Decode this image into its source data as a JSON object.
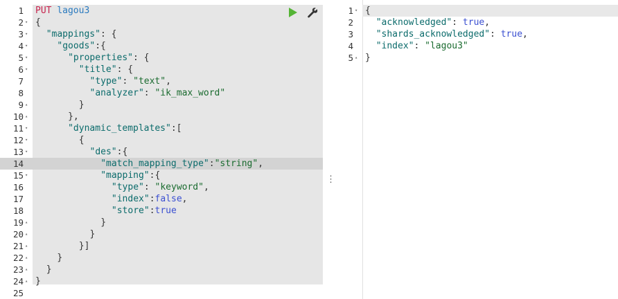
{
  "request": {
    "method": "PUT",
    "index": "lagou3",
    "lines": [
      {
        "n": "1",
        "fold": "",
        "indent": 0,
        "tokens": [
          [
            "method",
            "PUT"
          ],
          [
            "punc",
            " "
          ],
          [
            "url",
            "lagou3"
          ]
        ]
      },
      {
        "n": "2",
        "fold": "▾",
        "indent": 0,
        "tokens": [
          [
            "punc",
            "{"
          ]
        ]
      },
      {
        "n": "3",
        "fold": "▾",
        "indent": 1,
        "tokens": [
          [
            "key",
            "\"mappings\""
          ],
          [
            "punc",
            ": {"
          ]
        ]
      },
      {
        "n": "4",
        "fold": "▾",
        "indent": 2,
        "tokens": [
          [
            "key",
            "\"goods\""
          ],
          [
            "punc",
            ":{"
          ]
        ]
      },
      {
        "n": "5",
        "fold": "▾",
        "indent": 3,
        "tokens": [
          [
            "key",
            "\"properties\""
          ],
          [
            "punc",
            ": {"
          ]
        ]
      },
      {
        "n": "6",
        "fold": "▾",
        "indent": 4,
        "tokens": [
          [
            "key",
            "\"title\""
          ],
          [
            "punc",
            ": {"
          ]
        ]
      },
      {
        "n": "7",
        "fold": "",
        "indent": 5,
        "tokens": [
          [
            "key",
            "\"type\""
          ],
          [
            "punc",
            ": "
          ],
          [
            "str",
            "\"text\""
          ],
          [
            "punc",
            ","
          ]
        ]
      },
      {
        "n": "8",
        "fold": "",
        "indent": 5,
        "tokens": [
          [
            "key",
            "\"analyzer\""
          ],
          [
            "punc",
            ": "
          ],
          [
            "str",
            "\"ik_max_word\""
          ]
        ]
      },
      {
        "n": "9",
        "fold": "▴",
        "indent": 4,
        "tokens": [
          [
            "punc",
            "}"
          ]
        ]
      },
      {
        "n": "10",
        "fold": "▴",
        "indent": 3,
        "tokens": [
          [
            "punc",
            "},"
          ]
        ]
      },
      {
        "n": "11",
        "fold": "▾",
        "indent": 3,
        "tokens": [
          [
            "key",
            "\"dynamic_templates\""
          ],
          [
            "punc",
            ":["
          ]
        ]
      },
      {
        "n": "12",
        "fold": "▾",
        "indent": 4,
        "tokens": [
          [
            "punc",
            "{"
          ]
        ]
      },
      {
        "n": "13",
        "fold": "▾",
        "indent": 5,
        "tokens": [
          [
            "key",
            "\"des\""
          ],
          [
            "punc",
            ":{"
          ]
        ]
      },
      {
        "n": "14",
        "fold": "",
        "indent": 6,
        "tokens": [
          [
            "key",
            "\"match_mapping_type\""
          ],
          [
            "punc",
            ":"
          ],
          [
            "str",
            "\"string\""
          ],
          [
            "punc",
            ","
          ]
        ]
      },
      {
        "n": "15",
        "fold": "▾",
        "indent": 6,
        "tokens": [
          [
            "key",
            "\"mapping\""
          ],
          [
            "punc",
            ":{"
          ]
        ]
      },
      {
        "n": "16",
        "fold": "",
        "indent": 7,
        "tokens": [
          [
            "key",
            "\"type\""
          ],
          [
            "punc",
            ": "
          ],
          [
            "str",
            "\"keyword\""
          ],
          [
            "punc",
            ","
          ]
        ]
      },
      {
        "n": "17",
        "fold": "",
        "indent": 7,
        "tokens": [
          [
            "key",
            "\"index\""
          ],
          [
            "punc",
            ":"
          ],
          [
            "bool",
            "false"
          ],
          [
            "punc",
            ","
          ]
        ]
      },
      {
        "n": "18",
        "fold": "",
        "indent": 7,
        "tokens": [
          [
            "key",
            "\"store\""
          ],
          [
            "punc",
            ":"
          ],
          [
            "bool",
            "true"
          ]
        ]
      },
      {
        "n": "19",
        "fold": "▴",
        "indent": 6,
        "tokens": [
          [
            "punc",
            "}"
          ]
        ]
      },
      {
        "n": "20",
        "fold": "▴",
        "indent": 5,
        "tokens": [
          [
            "punc",
            "}"
          ]
        ]
      },
      {
        "n": "21",
        "fold": "▴",
        "indent": 4,
        "tokens": [
          [
            "punc",
            "}]"
          ]
        ]
      },
      {
        "n": "22",
        "fold": "▴",
        "indent": 2,
        "tokens": [
          [
            "punc",
            "}"
          ]
        ]
      },
      {
        "n": "23",
        "fold": "▴",
        "indent": 1,
        "tokens": [
          [
            "punc",
            "}"
          ]
        ]
      },
      {
        "n": "24",
        "fold": "▴",
        "indent": 0,
        "tokens": [
          [
            "punc",
            "}"
          ]
        ]
      },
      {
        "n": "25",
        "fold": "",
        "indent": 0,
        "tokens": []
      }
    ],
    "active_line": "14",
    "play_icon": "play-icon",
    "settings_icon": "wrench-icon",
    "play_color": "#54b435"
  },
  "response": {
    "lines": [
      {
        "n": "1",
        "fold": "▾",
        "indent": 0,
        "tokens": [
          [
            "punc",
            "{"
          ]
        ]
      },
      {
        "n": "2",
        "fold": "",
        "indent": 1,
        "tokens": [
          [
            "key",
            "\"acknowledged\""
          ],
          [
            "punc",
            ": "
          ],
          [
            "bool",
            "true"
          ],
          [
            "punc",
            ","
          ]
        ]
      },
      {
        "n": "3",
        "fold": "",
        "indent": 1,
        "tokens": [
          [
            "key",
            "\"shards_acknowledged\""
          ],
          [
            "punc",
            ": "
          ],
          [
            "bool",
            "true"
          ],
          [
            "punc",
            ","
          ]
        ]
      },
      {
        "n": "4",
        "fold": "",
        "indent": 1,
        "tokens": [
          [
            "key",
            "\"index\""
          ],
          [
            "punc",
            ": "
          ],
          [
            "str",
            "\"lagou3\""
          ]
        ]
      },
      {
        "n": "5",
        "fold": "▴",
        "indent": 0,
        "tokens": [
          [
            "punc",
            "}"
          ]
        ]
      }
    ]
  },
  "splitter": {
    "icon": "vertical-ellipsis-icon",
    "glyph": "⋮"
  }
}
